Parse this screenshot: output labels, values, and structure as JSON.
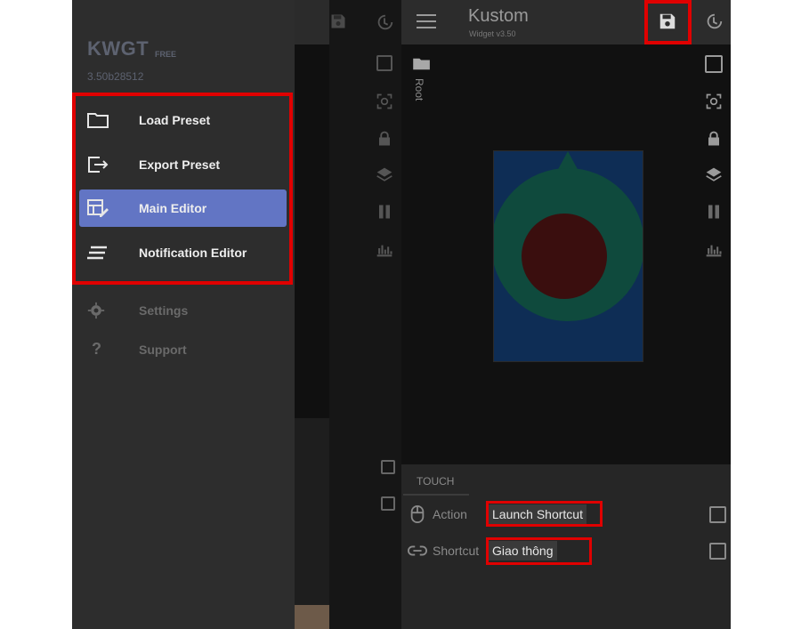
{
  "drawer": {
    "app_name": "KWGT",
    "tier": "FREE",
    "version": "3.50b28512",
    "menu_items": [
      {
        "label": "Load Preset",
        "icon": "folder-icon"
      },
      {
        "label": "Export Preset",
        "icon": "export-icon"
      },
      {
        "label": "Main Editor",
        "icon": "editor-icon",
        "active": true
      },
      {
        "label": "Notification Editor",
        "icon": "notification-icon"
      },
      {
        "label": "Settings",
        "icon": "gear-icon"
      },
      {
        "label": "Support",
        "icon": "help-icon"
      }
    ]
  },
  "editor": {
    "title": "Kustom",
    "subtitle": "Widget v3.50",
    "breadcrumb": "Root",
    "tab": "TOUCH",
    "rows": [
      {
        "label": "Action",
        "value": "Launch Shortcut",
        "icon": "mouse-icon"
      },
      {
        "label": "Shortcut",
        "value": "Giao thông",
        "icon": "link-icon"
      }
    ]
  },
  "colors": {
    "highlight": "#e00000",
    "active_menu": "#6275c4",
    "widget_blue": "#0e2d55",
    "widget_green": "#0f4a3d",
    "widget_red": "#3a0e0e"
  }
}
